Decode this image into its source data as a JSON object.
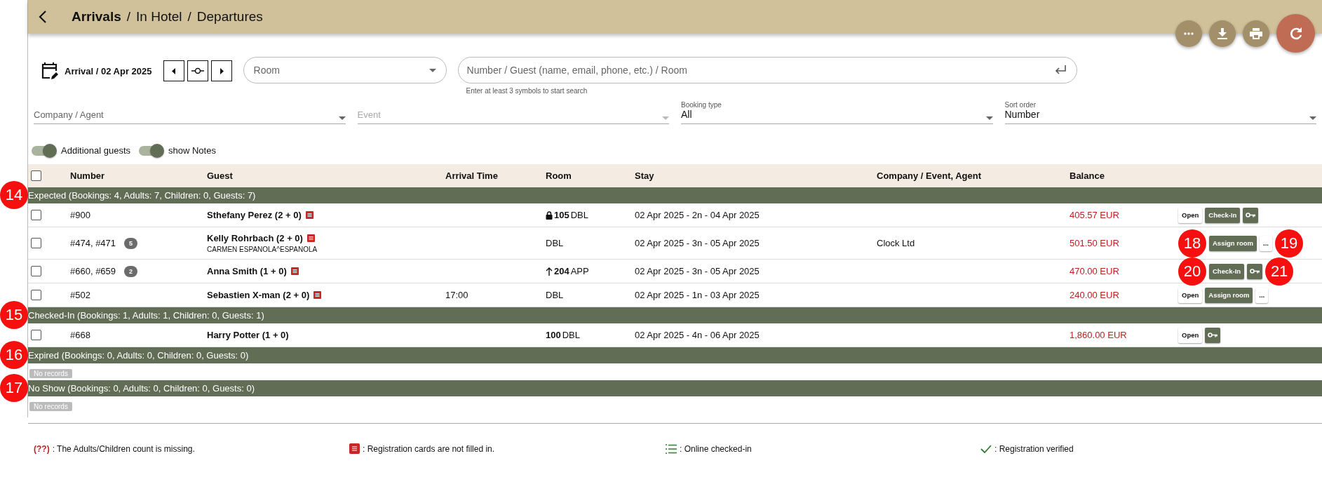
{
  "header": {
    "breadcrumbs": [
      {
        "kind": "crumb",
        "label": "Arrivals",
        "selected": true
      },
      {
        "kind": "separator",
        "label": "/"
      },
      {
        "kind": "crumb",
        "label": "In Hotel",
        "selected": false
      },
      {
        "kind": "separator",
        "label": "/"
      },
      {
        "kind": "crumb",
        "label": "Departures",
        "selected": false
      }
    ],
    "actions": [
      {
        "kind": "more"
      },
      {
        "kind": "download"
      },
      {
        "kind": "print"
      },
      {
        "kind": "refresh"
      }
    ]
  },
  "date_filter": {
    "label": "Arrival / 02 Apr 2025"
  },
  "room_select": {
    "placeholder": "Room"
  },
  "search": {
    "placeholder": "Number / Guest (name, email, phone, etc.) / Room",
    "hint": "Enter at least 3 symbols to start search"
  },
  "selects": [
    {
      "placeholder": "Company / Agent",
      "disabled": false
    },
    {
      "placeholder": "Event",
      "disabled": true
    },
    {
      "label": "Booking type",
      "value": "All",
      "disabled": false
    },
    {
      "label": "Sort order",
      "value": "Number",
      "disabled": false
    }
  ],
  "toggles": [
    {
      "label": "Additional guests",
      "on": true
    },
    {
      "label": "show Notes",
      "on": true
    }
  ],
  "table": {
    "select_all": {
      "checked": false
    },
    "columns": [
      "Number",
      "Guest",
      "Arrival Time",
      "Room",
      "Stay",
      "Company / Event, Agent",
      "Balance"
    ],
    "sections": [
      {
        "title": "Expected (Bookings: 4, Adults: 7, Children: 0, Guests: 7)",
        "callout": "14",
        "rows": [
          {
            "checked": false,
            "number": "#900",
            "guest": "Sthefany Perez (2 + 0)",
            "reg_card_missing": true,
            "locked": true,
            "upgraded": false,
            "room_number": "105",
            "room_type": "DBL",
            "stay": "02 Apr 2025 - 2n - 04 Apr 2025",
            "balance": "405.57 EUR",
            "actions": [
              {
                "kind": "open",
                "label": "Open"
              },
              {
                "kind": "primary",
                "label": "Check-In"
              },
              {
                "kind": "key"
              }
            ]
          },
          {
            "checked": false,
            "number": "#474, #471",
            "count": "5",
            "guest": "Kelly Rohrbach (2 + 0)",
            "reg_card_missing": true,
            "subline": "CARMEN ESPANOLA^ESPANOLA",
            "locked": false,
            "upgraded": false,
            "room_type": "DBL",
            "stay": "02 Apr 2025 - 3n - 05 Apr 2025",
            "company": "Clock Ltd",
            "balance": "501.50 EUR",
            "actions": [
              {
                "kind": "callout",
                "label": "18"
              },
              {
                "kind": "primary",
                "label": "Assign room"
              },
              {
                "kind": "open",
                "label": "..."
              },
              {
                "kind": "callout",
                "label": "19"
              }
            ]
          },
          {
            "checked": false,
            "number": "#660, #659",
            "count": "2",
            "guest": "Anna Smith (1 + 0)",
            "reg_card_missing": true,
            "locked": false,
            "upgraded": true,
            "room_number": "204",
            "room_type": "APP",
            "stay": "02 Apr 2025 - 3n - 05 Apr 2025",
            "balance": "470.00 EUR",
            "actions": [
              {
                "kind": "callout",
                "label": "20"
              },
              {
                "kind": "primary",
                "label": "Check-In"
              },
              {
                "kind": "key"
              },
              {
                "kind": "callout",
                "label": "21"
              }
            ]
          },
          {
            "checked": false,
            "number": "#502",
            "guest": "Sebastien X-man (2 + 0)",
            "reg_card_missing": true,
            "arrival_time": "17:00",
            "locked": false,
            "upgraded": false,
            "room_type": "DBL",
            "stay": "02 Apr 2025 - 1n - 03 Apr 2025",
            "balance": "240.00 EUR",
            "actions": [
              {
                "kind": "open",
                "label": "Open"
              },
              {
                "kind": "primary",
                "label": "Assign room"
              },
              {
                "kind": "open",
                "label": "..."
              }
            ]
          }
        ]
      },
      {
        "title": "Checked-In (Bookings: 1, Adults: 1, Children: 0, Guests: 1)",
        "callout": "15",
        "rows": [
          {
            "checked": false,
            "number": "#668",
            "guest": "Harry Potter (1 + 0)",
            "reg_card_missing": false,
            "locked": false,
            "upgraded": false,
            "room_number": "100",
            "room_type": "DBL",
            "stay": "02 Apr 2025 - 4n - 06 Apr 2025",
            "balance": "1,860.00 EUR",
            "actions": [
              {
                "kind": "open",
                "label": "Open"
              },
              {
                "kind": "key"
              }
            ]
          }
        ]
      },
      {
        "title": "Expired (Bookings: 0, Adults: 0, Children: 0, Guests: 0)",
        "callout": "16",
        "empty": "No records"
      },
      {
        "title": "No Show (Bookings: 0, Adults: 0, Children: 0, Guests: 0)",
        "callout": "17",
        "empty": "No records"
      }
    ]
  },
  "legend": [
    {
      "kind": "missing",
      "mark": "(??)",
      "text": ": The Adults/Children count is missing."
    },
    {
      "kind": "card",
      "text": ": Registration cards are not filled in."
    },
    {
      "kind": "online",
      "text": ": Online checked-in"
    },
    {
      "kind": "verified",
      "text": ": Registration verified"
    }
  ]
}
